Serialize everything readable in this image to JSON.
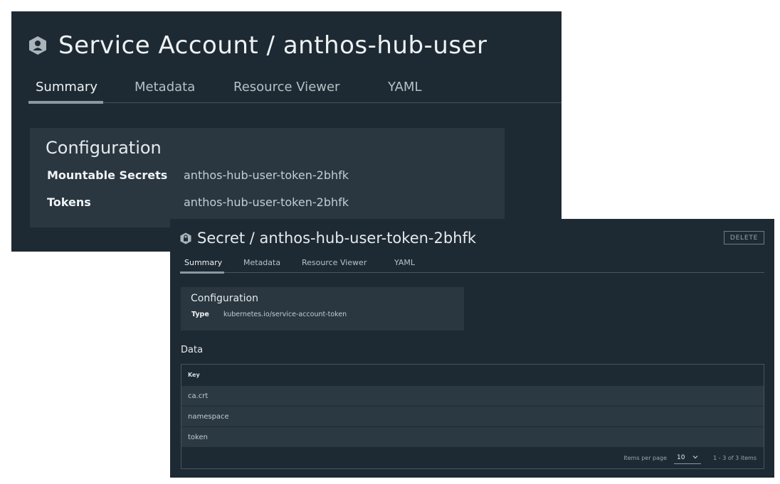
{
  "service_account": {
    "icon": "service-account-hexagon-icon",
    "title": "Service Account / anthos-hub-user",
    "tabs": [
      {
        "label": "Summary",
        "active": true
      },
      {
        "label": "Metadata",
        "active": false
      },
      {
        "label": "Resource Viewer",
        "active": false
      },
      {
        "label": "YAML",
        "active": false
      }
    ],
    "configuration": {
      "title": "Configuration",
      "fields": [
        {
          "label": "Mountable Secrets",
          "value": "anthos-hub-user-token-2bhfk"
        },
        {
          "label": "Tokens",
          "value": "anthos-hub-user-token-2bhfk"
        }
      ]
    }
  },
  "secret": {
    "icon": "secret-hexagon-icon",
    "title": "Secret / anthos-hub-user-token-2bhfk",
    "delete_label": "DELETE",
    "tabs": [
      {
        "label": "Summary",
        "active": true
      },
      {
        "label": "Metadata",
        "active": false
      },
      {
        "label": "Resource Viewer",
        "active": false
      },
      {
        "label": "YAML",
        "active": false
      }
    ],
    "configuration": {
      "title": "Configuration",
      "type_label": "Type",
      "type_value": "kubernetes.io/service-account-token"
    },
    "data": {
      "heading": "Data",
      "column_header": "Key",
      "rows": [
        "ca.crt",
        "namespace",
        "token"
      ],
      "items_per_page_label": "Items per page",
      "items_per_page_value": "10",
      "range_text": "1 - 3 of 3 items"
    }
  },
  "colors": {
    "panel_background": "#1e2a33",
    "card_background": "#2a3740",
    "row_background": "#2b3942",
    "active_underline": "#8a98a2"
  }
}
